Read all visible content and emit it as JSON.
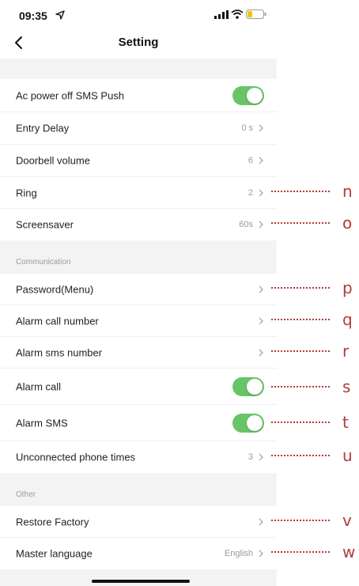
{
  "status": {
    "time": "09:35"
  },
  "nav": {
    "title": "Setting"
  },
  "sections": {
    "communication": "Communication",
    "other": "Other"
  },
  "rows": {
    "ac_power": {
      "label": "Ac power off SMS Push",
      "toggle_on": true
    },
    "entry_delay": {
      "label": "Entry Delay",
      "value": "0 s"
    },
    "doorbell_volume": {
      "label": "Doorbell volume",
      "value": "6"
    },
    "ring": {
      "label": "Ring",
      "value": "2"
    },
    "screensaver": {
      "label": "Screensaver",
      "value": "60s"
    },
    "password_menu": {
      "label": "Password(Menu)"
    },
    "alarm_call_number": {
      "label": "Alarm call number"
    },
    "alarm_sms_number": {
      "label": "Alarm sms number"
    },
    "alarm_call": {
      "label": "Alarm call",
      "toggle_on": true
    },
    "alarm_sms": {
      "label": "Alarm SMS",
      "toggle_on": true
    },
    "unconnected_phone_times": {
      "label": "Unconnected phone times",
      "value": "3"
    },
    "restore_factory": {
      "label": "Restore Factory"
    },
    "master_language": {
      "label": "Master language",
      "value": "English"
    }
  },
  "annotations": [
    "n",
    "o",
    "p",
    "q",
    "r",
    "s",
    "t",
    "u",
    "v",
    "w"
  ],
  "colors": {
    "toggle_on": "#67c567",
    "annotation": "#b33a3a",
    "background": "#f3f3f3"
  }
}
